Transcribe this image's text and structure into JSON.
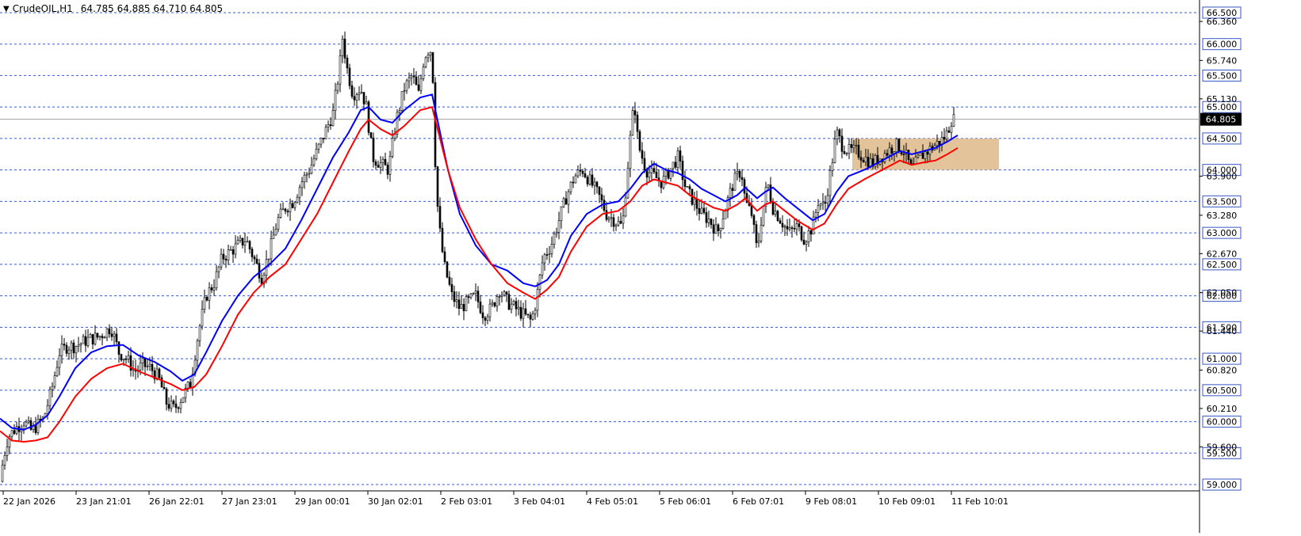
{
  "header": {
    "symbol": "CrudeOIL,H1",
    "ohlc": "64.785 64.885 64.710 64.805",
    "menu_icon": "triangle-down-icon"
  },
  "chart_data": {
    "type": "candlestick",
    "symbol": "CrudeOIL",
    "timeframe": "H1",
    "ylim": [
      58.9,
      66.6
    ],
    "current_price": "64.805",
    "grid": "dashed horizontal levels",
    "dashed_levels": [
      "66.500",
      "66.000",
      "65.500",
      "65.000",
      "64.500",
      "64.000",
      "63.500",
      "63.000",
      "62.500",
      "62.000",
      "61.500",
      "61.000",
      "60.500",
      "60.000",
      "59.500",
      "59.000"
    ],
    "scale_labels": [
      "66.360",
      "65.740",
      "65.130",
      "63.900",
      "63.280",
      "62.670",
      "62.050",
      "61.440",
      "60.820",
      "60.210",
      "59.600"
    ],
    "x_labels": [
      "22 Jan 2026",
      "23 Jan 21:01",
      "26 Jan 22:01",
      "27 Jan 23:01",
      "29 Jan 00:01",
      "30 Jan 02:01",
      "2 Feb 03:01",
      "3 Feb 04:01",
      "4 Feb 05:01",
      "5 Feb 06:01",
      "6 Feb 07:01",
      "9 Feb 08:01",
      "10 Feb 09:01",
      "11 Feb 10:01"
    ],
    "series": [
      {
        "kind": "close_trace",
        "points": [
          [
            0,
            59.05
          ],
          [
            4,
            59.4
          ],
          [
            10,
            59.75
          ],
          [
            20,
            59.9
          ],
          [
            30,
            60.0
          ],
          [
            40,
            59.85
          ],
          [
            55,
            60.05
          ],
          [
            65,
            60.5
          ],
          [
            75,
            61.1
          ],
          [
            85,
            61.2
          ],
          [
            95,
            61.2
          ],
          [
            110,
            61.3
          ],
          [
            125,
            61.35
          ],
          [
            140,
            61.5
          ],
          [
            150,
            61.1
          ],
          [
            160,
            61.0
          ],
          [
            170,
            60.8
          ],
          [
            180,
            60.9
          ],
          [
            190,
            60.85
          ],
          [
            200,
            60.7
          ],
          [
            210,
            60.3
          ],
          [
            220,
            60.2
          ],
          [
            230,
            60.4
          ],
          [
            240,
            60.6
          ],
          [
            250,
            61.4
          ],
          [
            260,
            62.0
          ],
          [
            270,
            62.2
          ],
          [
            280,
            62.6
          ],
          [
            290,
            62.7
          ],
          [
            300,
            62.8
          ],
          [
            310,
            62.9
          ],
          [
            320,
            62.6
          ],
          [
            330,
            62.3
          ],
          [
            340,
            62.7
          ],
          [
            350,
            63.2
          ],
          [
            360,
            63.4
          ],
          [
            370,
            63.5
          ],
          [
            380,
            63.8
          ],
          [
            390,
            64.0
          ],
          [
            400,
            64.3
          ],
          [
            410,
            64.6
          ],
          [
            420,
            64.9
          ],
          [
            428,
            65.6
          ],
          [
            432,
            66.1
          ],
          [
            438,
            65.6
          ],
          [
            445,
            65.2
          ],
          [
            455,
            65.3
          ],
          [
            462,
            65.0
          ],
          [
            470,
            64.2
          ],
          [
            480,
            64.1
          ],
          [
            490,
            64.0
          ],
          [
            500,
            64.8
          ],
          [
            510,
            65.3
          ],
          [
            520,
            65.5
          ],
          [
            528,
            65.2
          ],
          [
            535,
            65.8
          ],
          [
            540,
            65.9
          ],
          [
            545,
            65.9
          ],
          [
            550,
            63.7
          ],
          [
            555,
            63.0
          ],
          [
            560,
            62.5
          ],
          [
            570,
            62.0
          ],
          [
            580,
            61.8
          ],
          [
            590,
            61.9
          ],
          [
            600,
            62.0
          ],
          [
            610,
            61.7
          ],
          [
            620,
            61.8
          ],
          [
            630,
            62.1
          ],
          [
            640,
            61.9
          ],
          [
            650,
            61.8
          ],
          [
            660,
            61.7
          ],
          [
            670,
            61.6
          ],
          [
            676,
            61.9
          ],
          [
            685,
            62.6
          ],
          [
            695,
            62.8
          ],
          [
            705,
            63.2
          ],
          [
            715,
            63.6
          ],
          [
            725,
            63.9
          ],
          [
            735,
            64.0
          ],
          [
            745,
            63.8
          ],
          [
            755,
            63.6
          ],
          [
            765,
            63.3
          ],
          [
            775,
            63.2
          ],
          [
            785,
            63.1
          ],
          [
            795,
            64.5
          ],
          [
            800,
            65.1
          ],
          [
            805,
            64.4
          ],
          [
            815,
            64.0
          ],
          [
            825,
            63.9
          ],
          [
            835,
            63.8
          ],
          [
            845,
            64.0
          ],
          [
            855,
            64.2
          ],
          [
            865,
            63.7
          ],
          [
            875,
            63.5
          ],
          [
            885,
            63.3
          ],
          [
            895,
            63.2
          ],
          [
            905,
            63.0
          ],
          [
            915,
            63.4
          ],
          [
            925,
            63.8
          ],
          [
            935,
            64.0
          ],
          [
            940,
            63.5
          ],
          [
            948,
            63.3
          ],
          [
            955,
            62.7
          ],
          [
            960,
            63.2
          ],
          [
            968,
            63.8
          ],
          [
            975,
            63.4
          ],
          [
            985,
            63.2
          ],
          [
            995,
            63.0
          ],
          [
            1005,
            63.1
          ],
          [
            1015,
            62.9
          ],
          [
            1025,
            63.1
          ],
          [
            1032,
            63.5
          ],
          [
            1040,
            63.4
          ],
          [
            1048,
            64.0
          ],
          [
            1055,
            64.6
          ],
          [
            1062,
            64.4
          ],
          [
            1070,
            64.3
          ],
          [
            1080,
            64.3
          ],
          [
            1090,
            64.2
          ],
          [
            1100,
            64.1
          ],
          [
            1110,
            64.2
          ],
          [
            1120,
            64.3
          ],
          [
            1130,
            64.4
          ],
          [
            1140,
            64.3
          ],
          [
            1150,
            64.0
          ],
          [
            1160,
            64.2
          ],
          [
            1170,
            64.3
          ],
          [
            1180,
            64.4
          ],
          [
            1190,
            64.5
          ],
          [
            1195,
            64.6
          ],
          [
            1200,
            64.8
          ],
          [
            1205,
            64.8
          ]
        ]
      },
      {
        "kind": "moving_average",
        "color": "#0000ff",
        "points": [
          [
            0,
            60.05
          ],
          [
            15,
            59.9
          ],
          [
            30,
            59.87
          ],
          [
            45,
            59.95
          ],
          [
            60,
            60.1
          ],
          [
            75,
            60.4
          ],
          [
            95,
            60.85
          ],
          [
            115,
            61.1
          ],
          [
            135,
            61.2
          ],
          [
            155,
            61.22
          ],
          [
            175,
            61.05
          ],
          [
            195,
            60.95
          ],
          [
            215,
            60.8
          ],
          [
            230,
            60.65
          ],
          [
            245,
            60.75
          ],
          [
            260,
            61.1
          ],
          [
            280,
            61.6
          ],
          [
            300,
            62.0
          ],
          [
            320,
            62.3
          ],
          [
            340,
            62.5
          ],
          [
            360,
            62.75
          ],
          [
            380,
            63.2
          ],
          [
            400,
            63.7
          ],
          [
            420,
            64.2
          ],
          [
            440,
            64.6
          ],
          [
            455,
            64.95
          ],
          [
            465,
            65.0
          ],
          [
            480,
            64.8
          ],
          [
            495,
            64.75
          ],
          [
            510,
            64.95
          ],
          [
            530,
            65.15
          ],
          [
            545,
            65.2
          ],
          [
            555,
            64.6
          ],
          [
            565,
            64.0
          ],
          [
            580,
            63.3
          ],
          [
            600,
            62.8
          ],
          [
            620,
            62.5
          ],
          [
            640,
            62.4
          ],
          [
            660,
            62.2
          ],
          [
            675,
            62.15
          ],
          [
            690,
            62.25
          ],
          [
            705,
            62.5
          ],
          [
            720,
            62.95
          ],
          [
            740,
            63.3
          ],
          [
            760,
            63.45
          ],
          [
            780,
            63.5
          ],
          [
            795,
            63.7
          ],
          [
            810,
            63.95
          ],
          [
            825,
            64.1
          ],
          [
            840,
            64.0
          ],
          [
            855,
            63.95
          ],
          [
            870,
            63.85
          ],
          [
            885,
            63.7
          ],
          [
            900,
            63.6
          ],
          [
            915,
            63.5
          ],
          [
            930,
            63.6
          ],
          [
            940,
            63.72
          ],
          [
            955,
            63.55
          ],
          [
            965,
            63.65
          ],
          [
            975,
            63.72
          ],
          [
            990,
            63.55
          ],
          [
            1005,
            63.4
          ],
          [
            1025,
            63.2
          ],
          [
            1040,
            63.3
          ],
          [
            1055,
            63.65
          ],
          [
            1070,
            63.9
          ],
          [
            1090,
            64.0
          ],
          [
            1105,
            64.1
          ],
          [
            1120,
            64.2
          ],
          [
            1135,
            64.3
          ],
          [
            1150,
            64.25
          ],
          [
            1165,
            64.3
          ],
          [
            1180,
            64.35
          ],
          [
            1195,
            64.45
          ],
          [
            1208,
            64.55
          ]
        ]
      },
      {
        "kind": "moving_average",
        "color": "#ff0000",
        "points": [
          [
            0,
            59.85
          ],
          [
            15,
            59.7
          ],
          [
            30,
            59.68
          ],
          [
            45,
            59.7
          ],
          [
            60,
            59.75
          ],
          [
            75,
            60.0
          ],
          [
            95,
            60.4
          ],
          [
            115,
            60.68
          ],
          [
            135,
            60.85
          ],
          [
            155,
            60.92
          ],
          [
            175,
            60.8
          ],
          [
            195,
            60.7
          ],
          [
            215,
            60.6
          ],
          [
            230,
            60.5
          ],
          [
            245,
            60.55
          ],
          [
            260,
            60.75
          ],
          [
            280,
            61.2
          ],
          [
            300,
            61.7
          ],
          [
            320,
            62.05
          ],
          [
            340,
            62.3
          ],
          [
            360,
            62.5
          ],
          [
            380,
            62.9
          ],
          [
            400,
            63.3
          ],
          [
            420,
            63.8
          ],
          [
            440,
            64.3
          ],
          [
            455,
            64.65
          ],
          [
            465,
            64.8
          ],
          [
            480,
            64.65
          ],
          [
            495,
            64.55
          ],
          [
            510,
            64.7
          ],
          [
            530,
            64.95
          ],
          [
            545,
            65.0
          ],
          [
            555,
            64.5
          ],
          [
            565,
            64.0
          ],
          [
            580,
            63.4
          ],
          [
            600,
            62.9
          ],
          [
            620,
            62.5
          ],
          [
            640,
            62.2
          ],
          [
            660,
            62.05
          ],
          [
            675,
            61.95
          ],
          [
            690,
            62.1
          ],
          [
            705,
            62.3
          ],
          [
            720,
            62.7
          ],
          [
            740,
            63.1
          ],
          [
            760,
            63.3
          ],
          [
            780,
            63.35
          ],
          [
            795,
            63.5
          ],
          [
            810,
            63.75
          ],
          [
            825,
            63.85
          ],
          [
            840,
            63.8
          ],
          [
            855,
            63.75
          ],
          [
            870,
            63.6
          ],
          [
            885,
            63.5
          ],
          [
            900,
            63.4
          ],
          [
            915,
            63.35
          ],
          [
            930,
            63.45
          ],
          [
            940,
            63.55
          ],
          [
            955,
            63.35
          ],
          [
            965,
            63.45
          ],
          [
            975,
            63.5
          ],
          [
            990,
            63.35
          ],
          [
            1005,
            63.2
          ],
          [
            1025,
            63.05
          ],
          [
            1040,
            63.15
          ],
          [
            1055,
            63.45
          ],
          [
            1070,
            63.7
          ],
          [
            1090,
            63.85
          ],
          [
            1105,
            63.95
          ],
          [
            1120,
            64.05
          ],
          [
            1135,
            64.15
          ],
          [
            1150,
            64.08
          ],
          [
            1165,
            64.12
          ],
          [
            1180,
            64.15
          ],
          [
            1195,
            64.25
          ],
          [
            1208,
            64.35
          ]
        ]
      }
    ],
    "zone": {
      "from": 1075,
      "to": 1260,
      "y_low": 64.0,
      "y_high": 64.5,
      "color": "#deb887"
    }
  }
}
